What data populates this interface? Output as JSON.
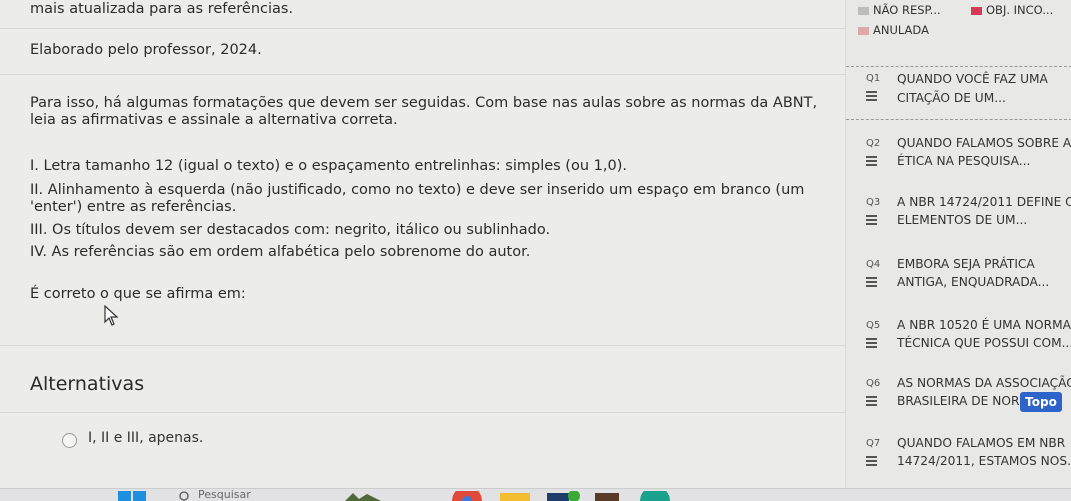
{
  "main": {
    "lines": [
      "mais atualizada para as referências.",
      "Elaborado pelo professor, 2024.",
      "Para isso, há algumas formatações que devem ser seguidas. Com base nas aulas sobre as normas da ABNT,",
      "leia as afirmativas e assinale a alternativa correta.",
      "I. Letra tamanho 12 (igual o texto) e o espaçamento entrelinhas: simples (ou 1,0).",
      "II. Alinhamento à esquerda (não justificado, como no texto) e deve ser inserido um espaço em branco (um",
      "'enter') entre as referências.",
      "III. Os títulos devem ser destacados com: negrito, itálico ou sublinhado.",
      "IV. As referências são em ordem alfabética pelo sobrenome do autor.",
      "É correto o que se afirma em:"
    ],
    "alternatives_title": "Alternativas",
    "alternatives": [
      "I, II e III, apenas."
    ]
  },
  "sidebar": {
    "legend": {
      "nao_resp": "NÃO RESP...",
      "obj_inco": "OBJ. INCO...",
      "anulada": "ANULADA",
      "colors": {
        "nao_resp": "#bdbdbb",
        "obj_inco": "#d63a57",
        "anulada": "#e0a9a9"
      }
    },
    "questions": [
      {
        "num": "Q1",
        "line1": "QUANDO VOCÊ FAZ UMA",
        "line2": "CITAÇÃO DE UM..."
      },
      {
        "num": "Q2",
        "line1": "QUANDO FALAMOS SOBRE A",
        "line2": "ÉTICA NA PESQUISA..."
      },
      {
        "num": "Q3",
        "line1": "A NBR 14724/2011 DEFINE OS",
        "line2": "ELEMENTOS DE UM..."
      },
      {
        "num": "Q4",
        "line1": "EMBORA SEJA PRÁTICA",
        "line2": "ANTIGA, ENQUADRADA..."
      },
      {
        "num": "Q5",
        "line1": "A NBR 10520 É UMA NORMA",
        "line2": "TÉCNICA QUE POSSUI COM..."
      },
      {
        "num": "Q6",
        "line1": "AS NORMAS DA ASSOCIAÇÃO",
        "line2": "BRASILEIRA DE NORMAS..."
      },
      {
        "num": "Q7",
        "line1": "QUANDO FALAMOS EM NBR",
        "line2": "14724/2011, ESTAMOS NOS..."
      }
    ],
    "topo_label": "Topo"
  },
  "taskbar": {
    "search_placeholder": "Pesquisar",
    "icons": [
      "windows-icon",
      "search-icon",
      "widgets-icon",
      "chrome-icon",
      "file-explorer-icon",
      "store-icon",
      "edge-icon"
    ]
  }
}
